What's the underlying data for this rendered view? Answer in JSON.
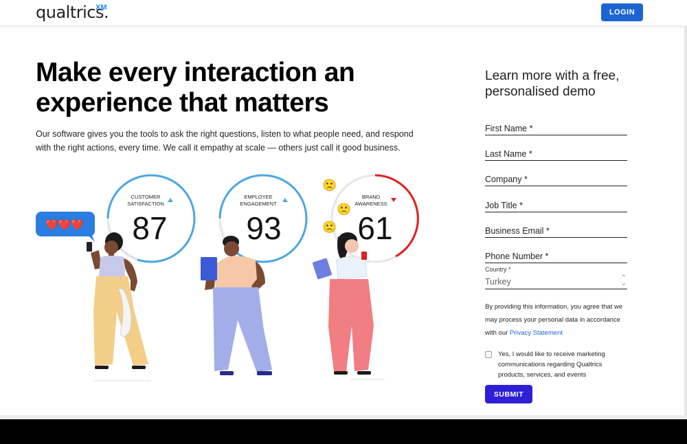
{
  "header": {
    "logo_text": "qualtrics.",
    "logo_xm": "XM",
    "login_label": "LOGIN"
  },
  "hero": {
    "title_line1": "Make every interaction an",
    "title_line2": "experience that matters",
    "description": "Our software gives you the tools to ask the right questions, listen to what people need, and respond with the right actions, every time. We call it empathy at scale — others just call it good business."
  },
  "metrics": [
    {
      "label_line1": "CUSTOMER",
      "label_line2": "SATISFACTION",
      "value": "87",
      "trend": "up",
      "ring_color": "#4aa6e0"
    },
    {
      "label_line1": "EMPLOYEE",
      "label_line2": "ENGAGEMENT",
      "value": "93",
      "trend": "up",
      "ring_color": "#4aa6e0"
    },
    {
      "label_line1": "BRAND",
      "label_line2": "AWARENESS",
      "value": "61",
      "trend": "down",
      "ring_color": "#e02020"
    }
  ],
  "illustration": {
    "chat_bubble_text": "❤️❤️❤️",
    "emoji": "🙁"
  },
  "form": {
    "title": "Learn more with a free, personalised demo",
    "fields": [
      {
        "label": "First Name *"
      },
      {
        "label": "Last Name *"
      },
      {
        "label": "Company *"
      },
      {
        "label": "Job Title *"
      },
      {
        "label": "Business Email *"
      },
      {
        "label": "Phone Number *"
      }
    ],
    "country_label": "Country *",
    "country_value": "Turkey",
    "consent_text": "By providing this information, you agree that we may process your personal data in accordance with our",
    "privacy_link": "Privacy Statement",
    "marketing_checkbox_label": "Yes, I would like to receive marketing communications regarding Qualtrics products, services, and events",
    "submit_label": "SUBMIT"
  },
  "colors": {
    "login_button": "#1e64d1",
    "submit_button": "#2e1fd6",
    "ring_blue": "#4aa6e0",
    "ring_red": "#e02020",
    "bubble_blue": "#2a7de1"
  }
}
